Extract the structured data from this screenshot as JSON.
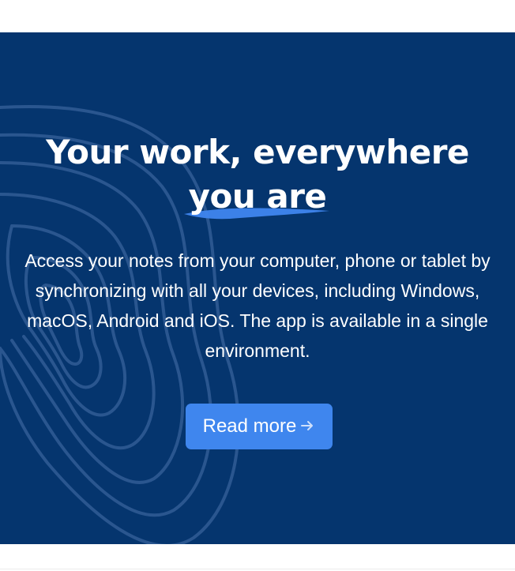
{
  "hero": {
    "title_line1": "Your work, everywhere",
    "title_highlight": "you are",
    "description": "Access your notes from your computer, phone or tablet by synchronizing with all your devices, including Windows, macOS, Android and iOS. The app is available in a single environment.",
    "button_label": "Read more",
    "button_icon": "arrow-right-icon",
    "background_icon": "contour-lines-pattern"
  },
  "colors": {
    "hero_background": "#05356e",
    "button_background": "#3f86ee",
    "highlight_stroke": "#3f86ee",
    "contour_stroke": "#2f5a93",
    "text": "#ffffff"
  }
}
